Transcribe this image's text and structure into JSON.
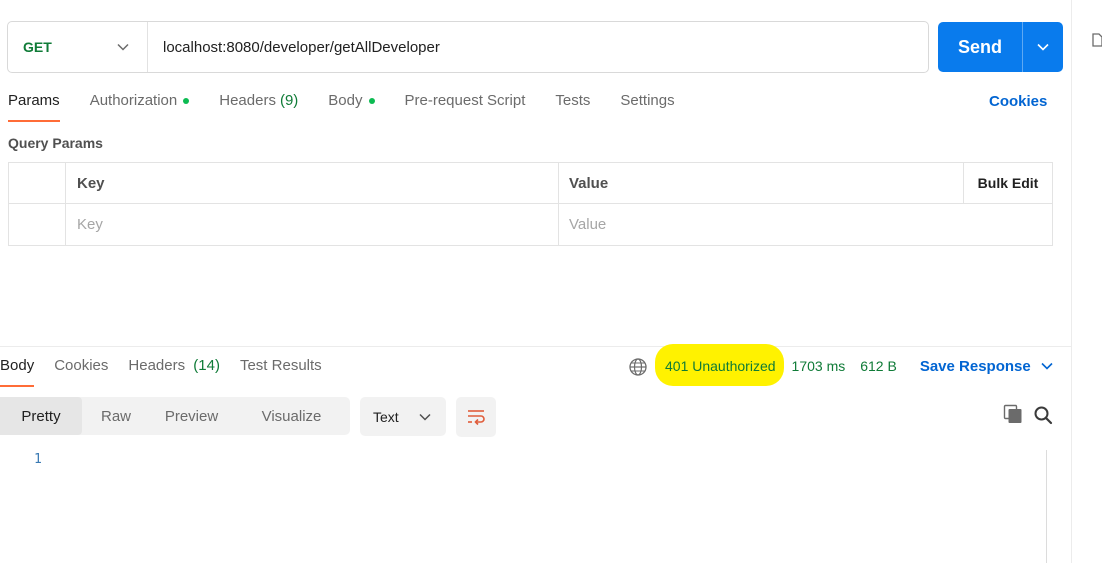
{
  "request": {
    "method": "GET",
    "url": "localhost:8080/developer/getAllDeveloper",
    "send_label": "Send"
  },
  "request_tabs": [
    {
      "label": "Params",
      "active": true
    },
    {
      "label": "Authorization",
      "dot": true
    },
    {
      "label": "Headers",
      "count": "(9)"
    },
    {
      "label": "Body",
      "dot": true
    },
    {
      "label": "Pre-request Script"
    },
    {
      "label": "Tests"
    },
    {
      "label": "Settings"
    }
  ],
  "cookies_link": "Cookies",
  "query_params": {
    "title": "Query Params",
    "columns": {
      "key": "Key",
      "value": "Value",
      "bulk_edit": "Bulk Edit"
    },
    "placeholders": {
      "key": "Key",
      "value": "Value"
    }
  },
  "response_tabs": [
    {
      "label": "Body",
      "active": true
    },
    {
      "label": "Cookies"
    },
    {
      "label": "Headers",
      "count": "(14)"
    },
    {
      "label": "Test Results"
    }
  ],
  "response_status": {
    "status": "401 Unauthorized",
    "time": "1703 ms",
    "size": "612 B",
    "save_label": "Save Response",
    "highlight_color": "#fff200"
  },
  "format_tabs": [
    {
      "label": "Pretty",
      "active": true
    },
    {
      "label": "Raw"
    },
    {
      "label": "Preview"
    },
    {
      "label": "Visualize"
    }
  ],
  "text_format": "Text",
  "response_body": {
    "line_numbers": [
      "1"
    ]
  },
  "colors": {
    "primary": "#097bed",
    "method_get": "#0f7b37",
    "active_tab_underline": "#ff6c37",
    "link": "#0265d2",
    "dot": "#0cbb52"
  },
  "icons": [
    "chevron-down-icon",
    "globe-icon",
    "wrap-lines-icon",
    "copy-icon",
    "search-icon",
    "side-panel-icon"
  ]
}
